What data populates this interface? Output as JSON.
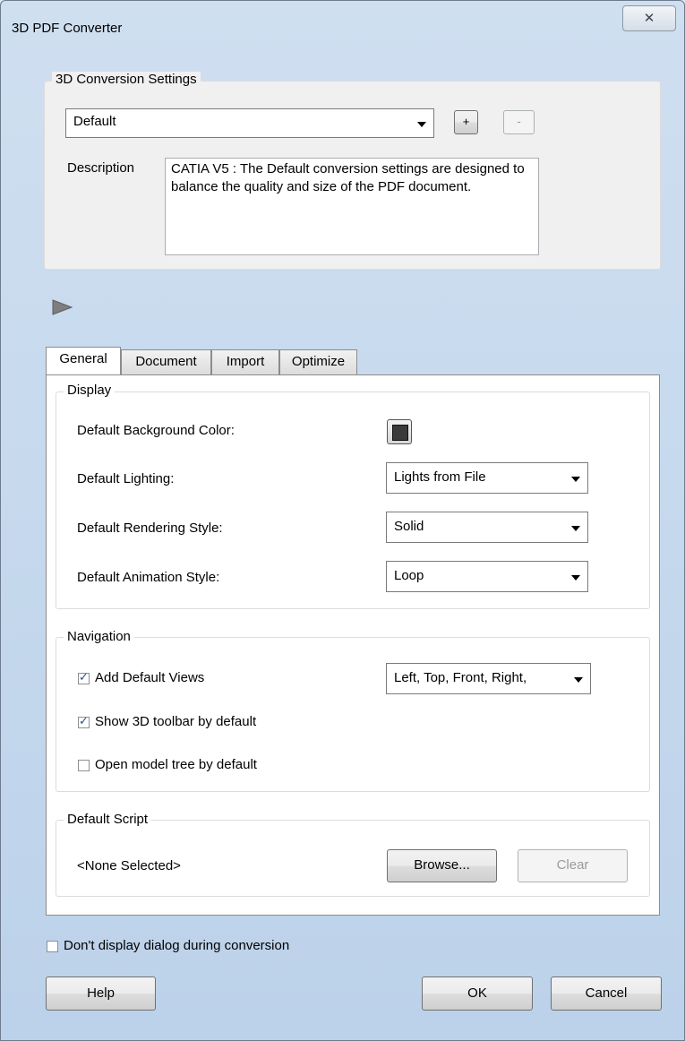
{
  "window": {
    "title": "3D PDF Converter",
    "close_glyph": "✕"
  },
  "settings_group": {
    "legend": "3D Conversion Settings",
    "preset_value": "Default",
    "add_label": "+",
    "remove_label": "-",
    "description_label": "Description",
    "description_text": "CATIA V5 : The Default conversion settings are designed to balance the quality and size of the PDF document."
  },
  "tabs": [
    {
      "label": "General",
      "active": true
    },
    {
      "label": "Document",
      "active": false
    },
    {
      "label": "Import",
      "active": false
    },
    {
      "label": "Optimize",
      "active": false
    }
  ],
  "display": {
    "legend": "Display",
    "bg_color_label": "Default Background Color:",
    "bg_color": "#3a3a3a",
    "lighting_label": "Default Lighting:",
    "lighting_value": "Lights from File",
    "rendering_label": "Default Rendering Style:",
    "rendering_value": "Solid",
    "animation_label": "Default Animation Style:",
    "animation_value": "Loop"
  },
  "navigation": {
    "legend": "Navigation",
    "default_views_label": "Add Default Views",
    "default_views_checked": true,
    "default_views_value": "Left, Top, Front, Right,",
    "toolbar_label": "Show 3D toolbar by default",
    "toolbar_checked": true,
    "model_tree_label": "Open model tree by default",
    "model_tree_checked": false
  },
  "script": {
    "legend": "Default Script",
    "selected": "<None Selected>",
    "browse_label": "Browse...",
    "clear_label": "Clear"
  },
  "footer": {
    "dont_display_label": "Don't display dialog during conversion",
    "dont_display_checked": false,
    "help_label": "Help",
    "ok_label": "OK",
    "cancel_label": "Cancel"
  }
}
